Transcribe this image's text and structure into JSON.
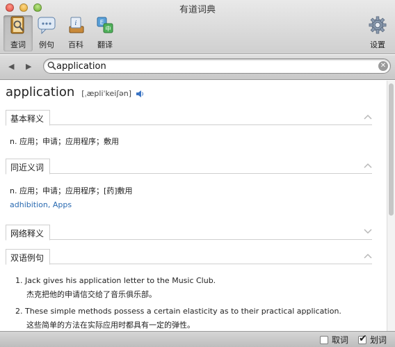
{
  "window": {
    "title": "有道词典"
  },
  "toolbar": {
    "lookup_label": "查词",
    "sentences_label": "例句",
    "encyclopedia_label": "百科",
    "translate_label": "翻译",
    "settings_label": "设置"
  },
  "search": {
    "value": "application"
  },
  "entry": {
    "word": "application",
    "phonetic": "[ˌæpliˈkeiʃən]"
  },
  "sections": {
    "basic": {
      "title": "基本释义",
      "definition": "n. 应用；申请；应用程序；敷用"
    },
    "synonyms": {
      "title": "同近义词",
      "definition": "n. 应用；申请；应用程序；[药]敷用",
      "links": "adhibition, Apps"
    },
    "web": {
      "title": "网络释义"
    },
    "bilingual": {
      "title": "双语例句",
      "examples": [
        {
          "num": "1.",
          "en": "Jack gives his application letter to the Music Club.",
          "zh": "杰克把他的申请信交给了音乐俱乐部。"
        },
        {
          "num": "2.",
          "en": "These simple methods possess a certain elasticity as to their practical application.",
          "zh": "这些简单的方法在实际应用时都具有一定的弹性。"
        }
      ]
    }
  },
  "footer": {
    "get_word_label": "取词",
    "get_word_checked": false,
    "select_word_label": "划词",
    "select_word_checked": true
  }
}
